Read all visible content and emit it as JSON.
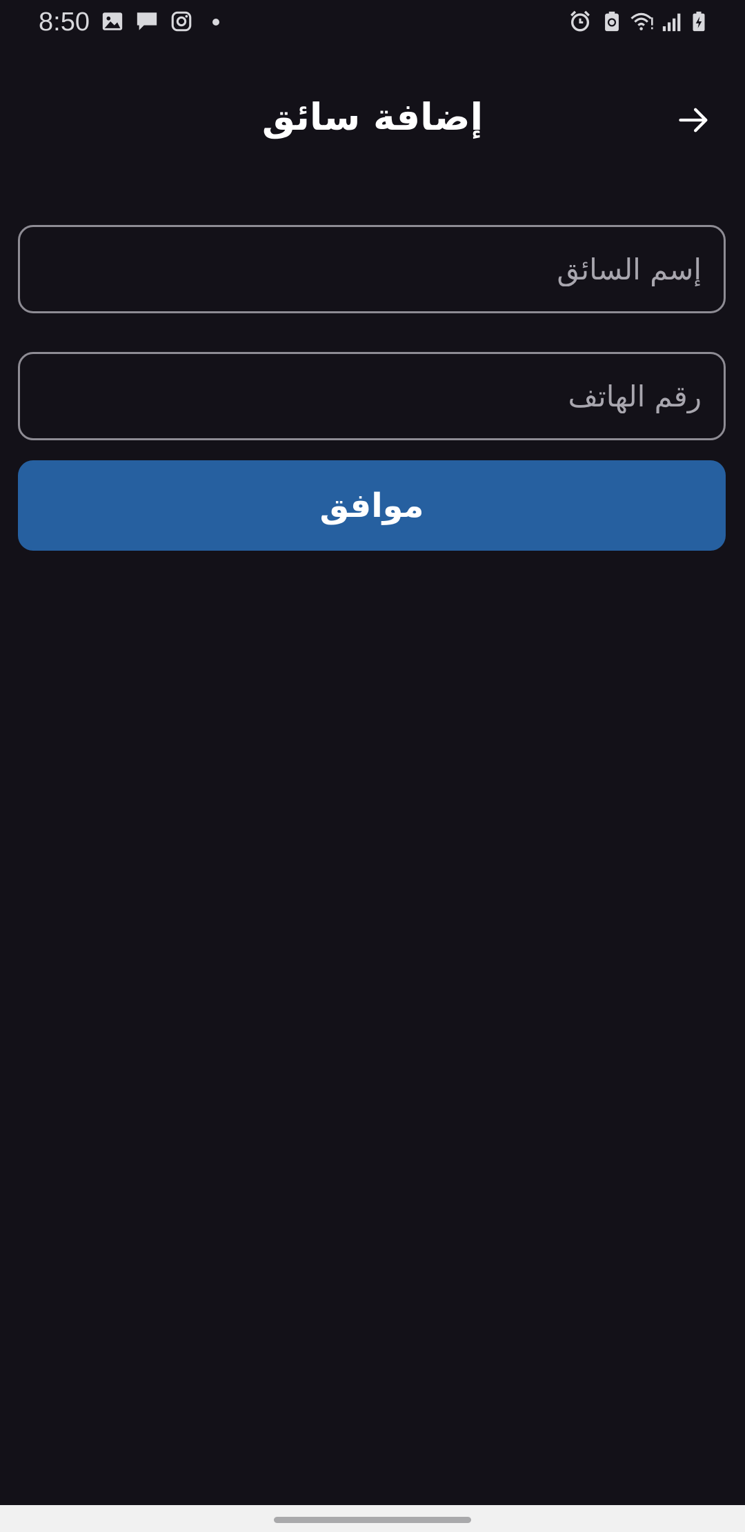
{
  "status_bar": {
    "time": "8:50",
    "left_icons": [
      "gallery-icon",
      "message-icon",
      "instagram-icon",
      "notification-dot"
    ],
    "right_icons": [
      "alarm-icon",
      "battery-saver-icon",
      "wifi-icon",
      "signal-icon",
      "battery-charging-icon"
    ]
  },
  "header": {
    "title": "إضافة سائق",
    "back_icon": "arrow-right-icon"
  },
  "form": {
    "driver_name": {
      "placeholder": "إسم السائق",
      "value": ""
    },
    "phone_number": {
      "placeholder": "رقم الهاتف",
      "value": ""
    },
    "submit_label": "موافق"
  },
  "colors": {
    "background": "#131118",
    "primary_button": "#2660a0",
    "field_border": "#8e8c94",
    "nav_bar": "#f1f1f1"
  }
}
